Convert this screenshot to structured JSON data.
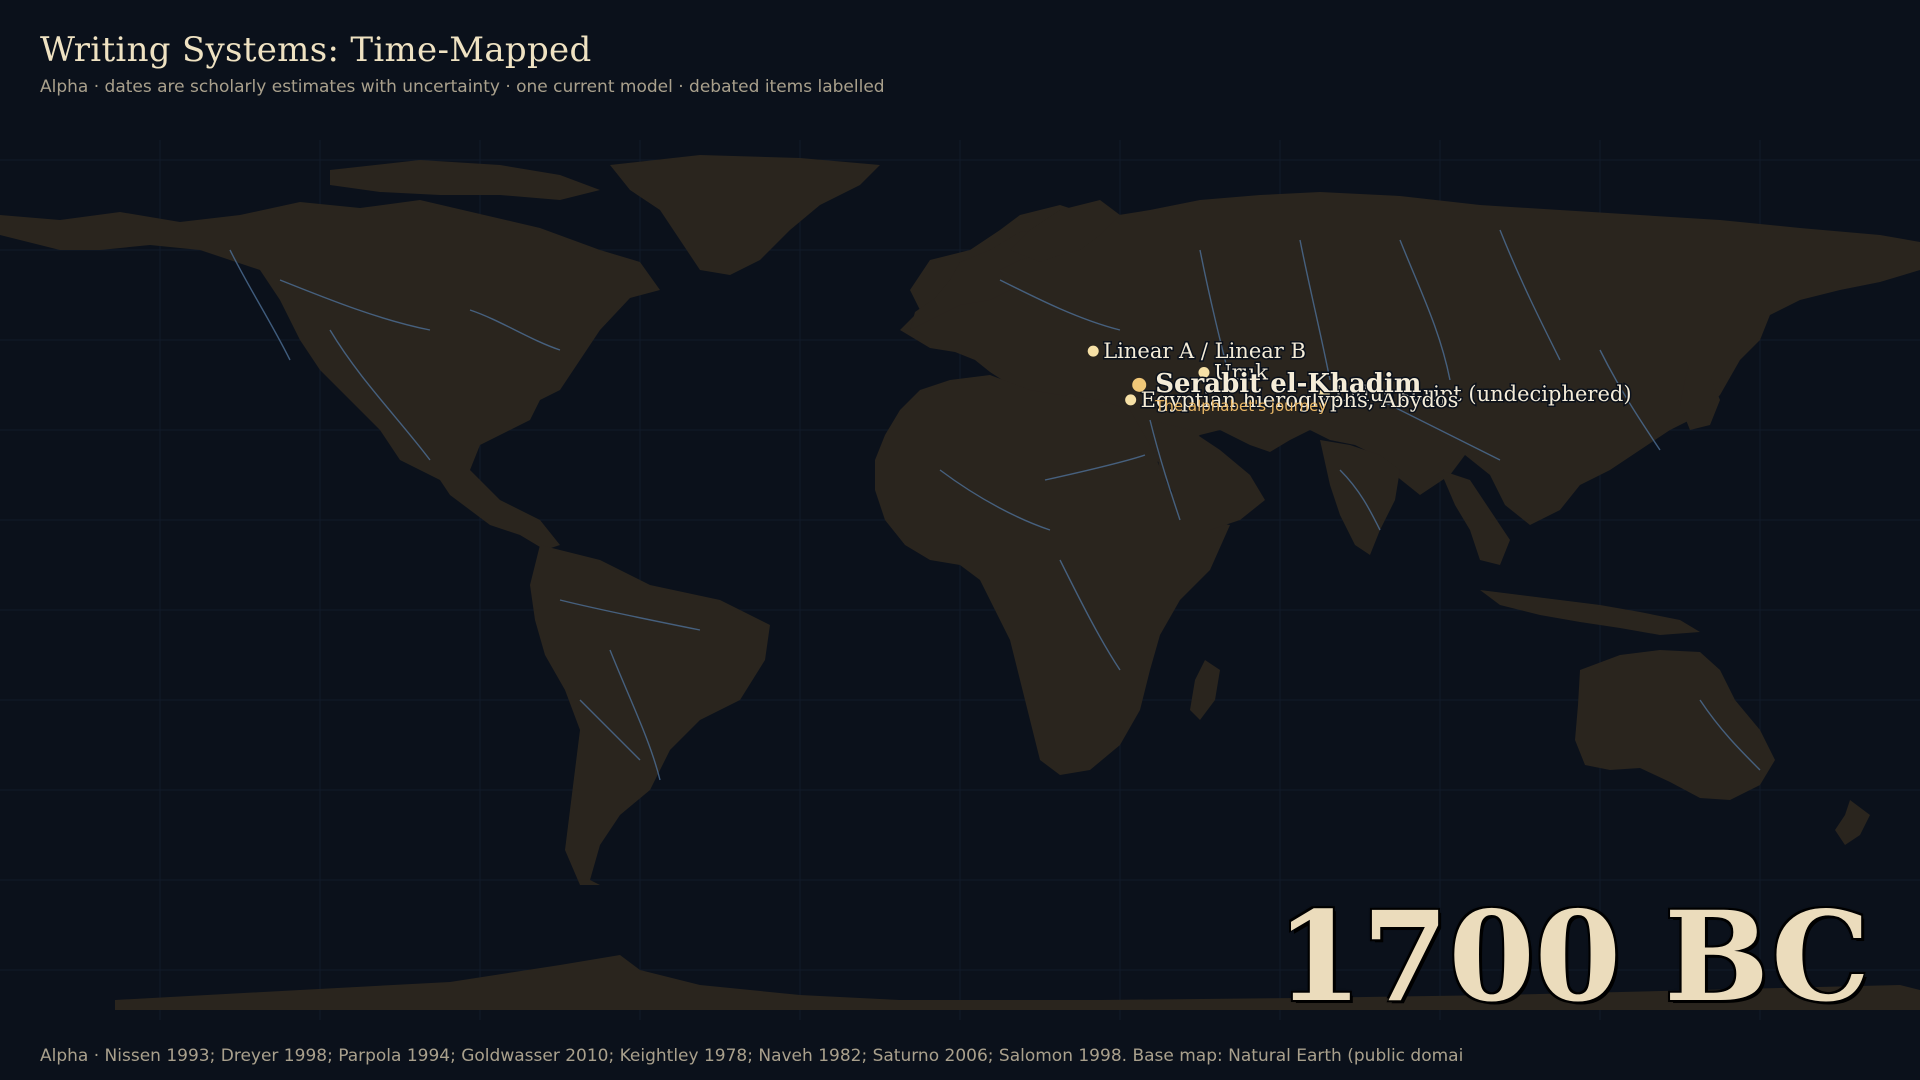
{
  "header": {
    "title": "Writing Systems: Time-Mapped",
    "subtitle": "Alpha · dates are scholarly estimates with uncertainty · one current model · debated items labelled"
  },
  "map": {
    "current_year": "1700 BC",
    "sites": [
      {
        "label": "Linear A / Linear B",
        "lon": 24.9,
        "lat": 35.3,
        "current": false
      },
      {
        "label": "Uruk",
        "lon": 45.6,
        "lat": 31.3,
        "current": false
      },
      {
        "label": "Indus script (undeciphered)",
        "lon": 68.1,
        "lat": 27.3,
        "current": false
      },
      {
        "label": "Egyptian hieroglyphs, Abydos",
        "lon": 31.9,
        "lat": 26.2,
        "current": false
      },
      {
        "label": "Serabit el-Khadim",
        "lon": 33.5,
        "lat": 29.0,
        "current": true
      }
    ],
    "journey_label": "The alphabet's journey",
    "colors": {
      "land": "#2a251e",
      "ocean": "#0b111b",
      "rivers": "#4d6f96",
      "marker": "#f7e1a6",
      "current_marker": "#f1c878"
    }
  },
  "footer": {
    "sources": "Alpha · Nissen 1993; Dreyer 1998; Parpola 1994; Goldwasser 2010; Keightley 1978; Naveh 1982; Saturno 2006; Salomon 1998. Base map: Natural Earth (public domai"
  }
}
